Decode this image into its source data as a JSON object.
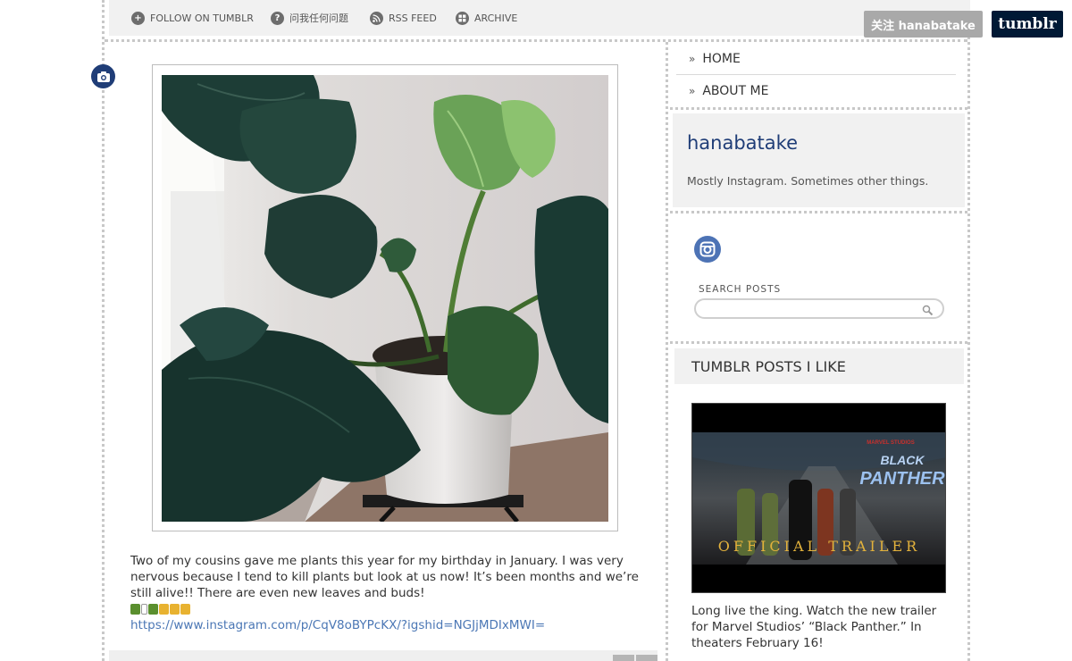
{
  "topnav": {
    "items": [
      {
        "label": "FOLLOW ON TUMBLR",
        "icon": "plus-circle-icon"
      },
      {
        "label": "问我任何问题",
        "icon": "question-circle-icon"
      },
      {
        "label": "RSS FEED",
        "icon": "rss-icon"
      },
      {
        "label": "ARCHIVE",
        "icon": "archive-icon"
      }
    ]
  },
  "tumblr_controls": {
    "follow_label": "关注 hanabatake",
    "brand_label": "tumblr"
  },
  "post": {
    "type_icon": "camera-icon",
    "caption_text": "Two of my cousins gave me plants this year for my birthday in January. I was very nervous because I tend to kill plants but look at us now! It’s been months and we’re still alive!! There are even new leaves and buds!",
    "emoji_colors": [
      "#5a8f2e",
      "#cccccc",
      "#5a8f2e",
      "#e8b230",
      "#e8b230",
      "#e8b230"
    ],
    "link": "https://www.instagram.com/p/CqV8oBYPcKX/?igshid=NGJjMDIxMWI="
  },
  "sidebar": {
    "nav": [
      {
        "label": "HOME"
      },
      {
        "label": "ABOUT ME"
      }
    ],
    "blog_title": "hanabatake",
    "blog_description": "Mostly Instagram. Sometimes other things.",
    "instagram_icon": "instagram-icon",
    "search_label": "SEARCH POSTS",
    "search_value": "",
    "likes_heading": "TUMBLR POSTS I LIKE",
    "liked_post": {
      "video_brand": "MARVEL STUDIOS",
      "video_title_line1": "BLACK",
      "video_title_line2": "PANTHER",
      "video_banner": "OFFICIAL TRAILER",
      "description": "Long live the king. Watch the new trailer for Marvel Studios’ “Black Panther.” In theaters February 16!"
    }
  },
  "colors": {
    "accent_navy": "#1f3d77",
    "link_blue": "#4b77b5",
    "tumblr_navy": "#001935",
    "panel_gray": "#f1f1f1"
  }
}
